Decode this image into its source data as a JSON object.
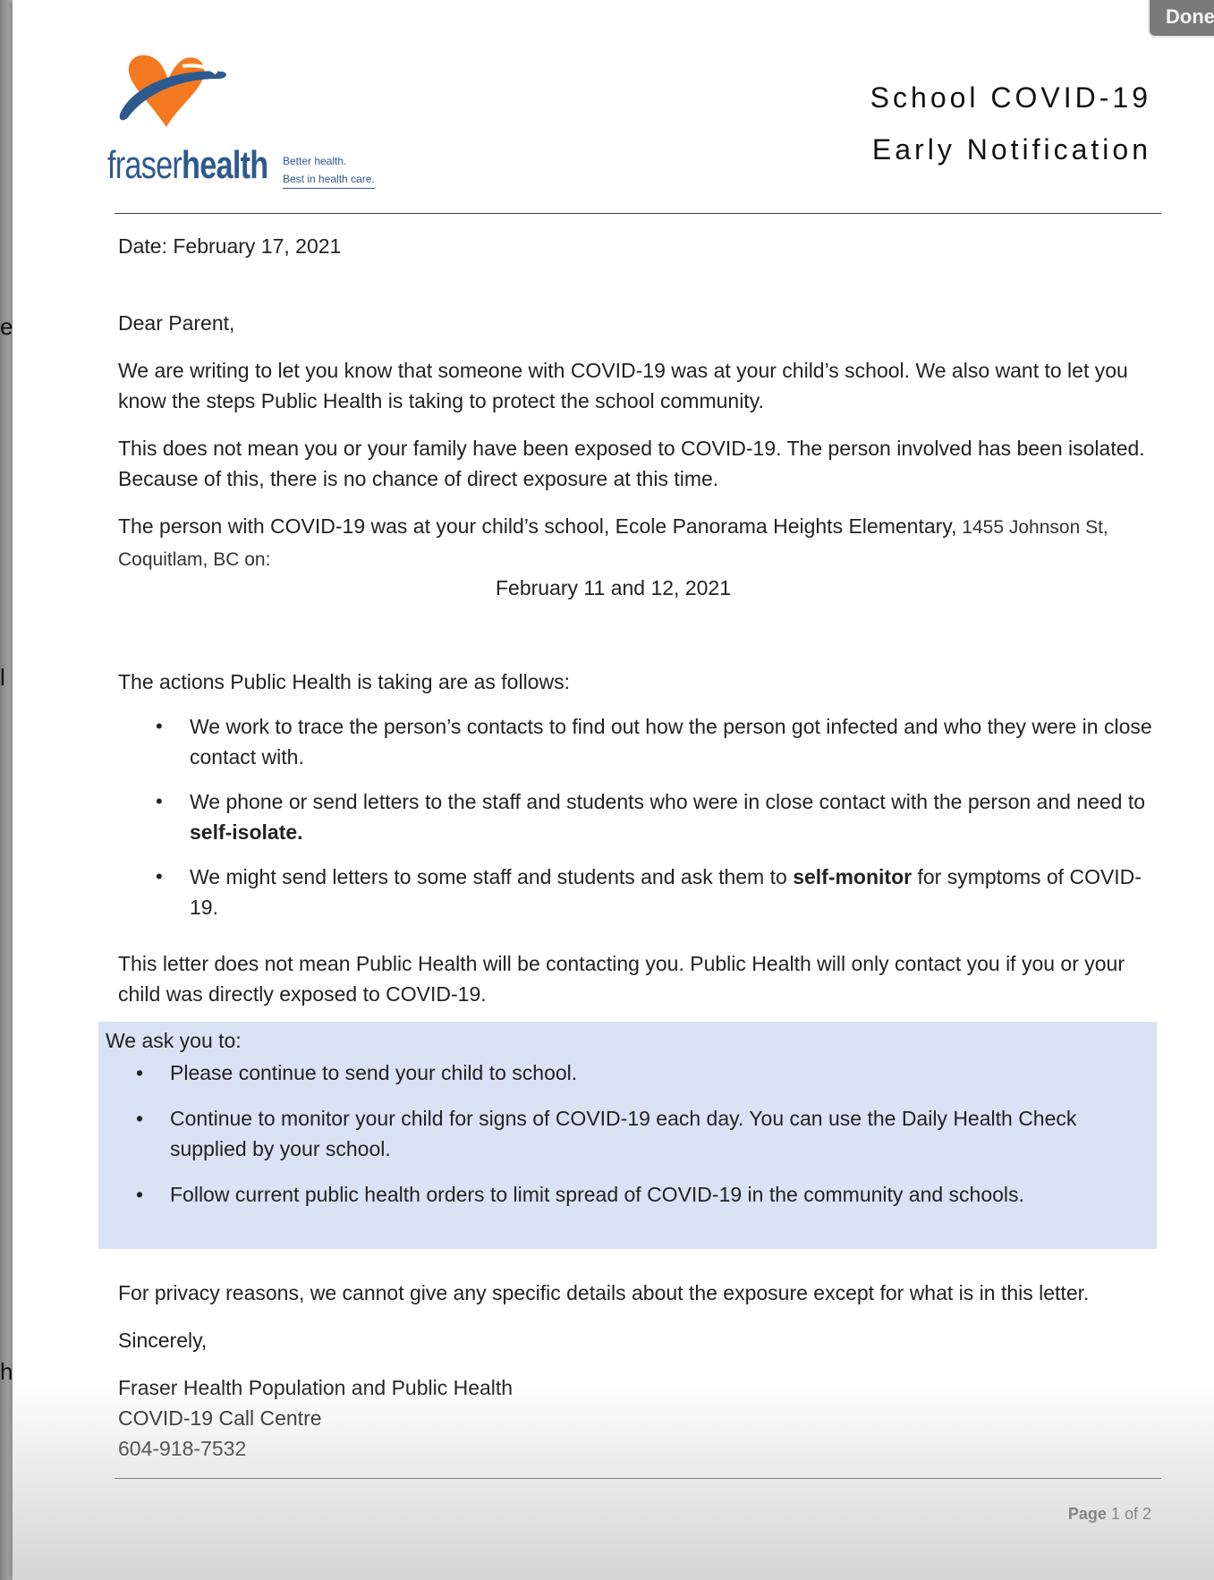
{
  "ui": {
    "done_label": "Done"
  },
  "logo": {
    "name_light": "fraser",
    "name_bold": "health",
    "tagline_1": "Better health.",
    "tagline_2": "Best in health care.",
    "colors": {
      "orange": "#f47920",
      "blue": "#2d5a8e"
    }
  },
  "header": {
    "title_line_1": "School COVID-19",
    "title_line_2": "Early Notification"
  },
  "letter": {
    "date": "Date: February 17, 2021",
    "salutation": "Dear Parent,",
    "para1": "We are writing to let you know that someone with COVID-19 was at your child’s school. We also want to let you know the steps Public Health is taking to protect the school community.",
    "para2": "This does not mean you or your family have been exposed to COVID-19. The person involved has been isolated. Because of this, there is no chance of direct exposure at this time.",
    "para3_main": "The person with COVID-19 was at your child’s school, Ecole Panorama Heights Elementary,",
    "para3_addr": " 1455 Johnson St, Coquitlam, BC on:",
    "exposure_dates": "February 11 and 12, 2021",
    "actions_intro": "The actions Public Health is taking are as follows:",
    "actions": [
      {
        "text": "We work to trace the person’s contacts to find out how the person got infected and who they were in close contact with.",
        "bold": "",
        "after": ""
      },
      {
        "text": "We phone or send letters to the staff and students who were in close contact with the person and need to ",
        "bold": "self-isolate.",
        "after": ""
      },
      {
        "text": "We might send letters to some staff and students and ask them to ",
        "bold": "self-monitor",
        "after": " for symptoms of COVID-19."
      }
    ],
    "para4": "This letter does not mean Public Health will be contacting you. Public Health will only contact you if you or your child was directly exposed to COVID-19.",
    "ask_intro": "We ask you to:",
    "asks": [
      "Please continue to send your child to school.",
      "Continue to monitor your child for signs of COVID-19 each day.  You can use the Daily Health Check supplied by your school.",
      "Follow current public health orders to limit spread of COVID-19 in the community and schools."
    ],
    "privacy": "For privacy reasons, we cannot give any specific details about the exposure except for what is in this letter.",
    "closing": "Sincerely,",
    "signature_1": "Fraser Health Population and Public Health",
    "signature_2": "COVID-19 Call Centre",
    "signature_3": "604-918-7532"
  },
  "footer": {
    "page_label": "Page",
    "page_count": "1 of 2"
  },
  "background_fragments": [
    "e",
    "l",
    "h"
  ]
}
